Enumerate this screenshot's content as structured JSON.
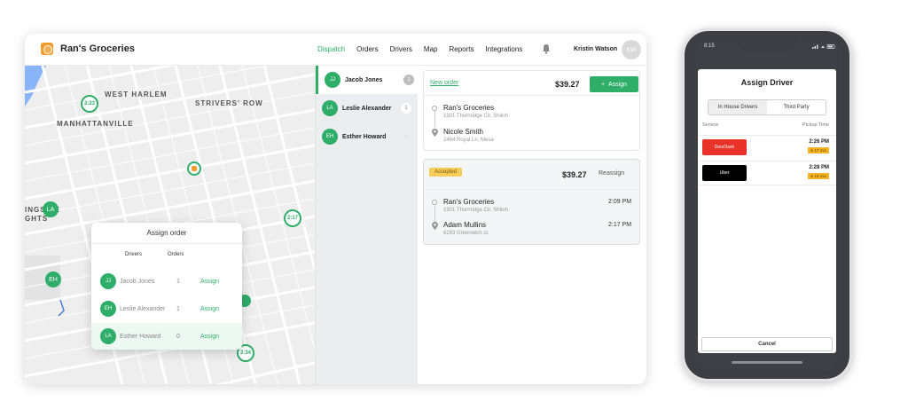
{
  "app": {
    "name": "Ran's Groceries",
    "nav": [
      "Dispatch",
      "Orders",
      "Drivers",
      "Map",
      "Reports",
      "Integrations"
    ],
    "active_nav": "Dispatch",
    "user_name": "Kristin Watson",
    "user_initials": "KW",
    "accent": "#2fae6a"
  },
  "map": {
    "labels": [
      "WEST HARLEM",
      "STRIVERS' ROW",
      "MANHATTANVILLE",
      "INGSIDE",
      "GHTS"
    ],
    "time_pins": [
      "2:23",
      "2:17",
      "2:34"
    ],
    "driver_pins": [
      "LA",
      "EH"
    ]
  },
  "assign_popup": {
    "title": "Assign order",
    "col_drivers": "Drivers",
    "col_orders": "Orders",
    "rows": [
      {
        "initials": "JJ",
        "name": "Jacob Jones",
        "orders": "1",
        "action": "Assign"
      },
      {
        "initials": "EH",
        "name": "Leslie Alexander",
        "orders": "1",
        "action": "Assign"
      },
      {
        "initials": "LA",
        "name": "Esther Howard",
        "orders": "0",
        "action": "Assign"
      }
    ]
  },
  "drivers": [
    {
      "initials": "JJ",
      "name": "Jacob Jones",
      "count": "1"
    },
    {
      "initials": "LA",
      "name": "Leslie Alexander",
      "count": "1"
    },
    {
      "initials": "EH",
      "name": "Esther Howard",
      "count": "1"
    }
  ],
  "orders": [
    {
      "link": "New order",
      "price": "$39.27",
      "action": "Assign",
      "pickup": {
        "name": "Ran's Groceries",
        "address": "1901 Thornridge Cir. Shiloh"
      },
      "dropoff": {
        "name": "Nicole Smith",
        "address": "2464 Royal Ln. Mesa"
      }
    },
    {
      "status": "Accepted",
      "price": "$39.27",
      "action": "Reassign",
      "pickup": {
        "name": "Ran's Groceries",
        "address": "1901 Thornridge Cir. Shiloh",
        "time": "2:09 PM"
      },
      "dropoff": {
        "name": "Adam Mullins",
        "address": "6293 Greenwich st.",
        "time": "2:17 PM"
      }
    }
  ],
  "phone": {
    "status_time": "8:15",
    "title": "Assign Driver",
    "tabs": [
      "In House Drivers",
      "Third Party"
    ],
    "active_tab": "Third Party",
    "col_service": "Service",
    "col_pickup": "Pickup Time",
    "services": [
      {
        "logo": "DoorDash",
        "color": "#e8322a",
        "time": "2:26 PM",
        "eta": "in 17 min"
      },
      {
        "logo": "Uber",
        "color": "#000000",
        "time": "2:28 PM",
        "eta": "in 19 min"
      }
    ],
    "cancel": "Cancel"
  }
}
